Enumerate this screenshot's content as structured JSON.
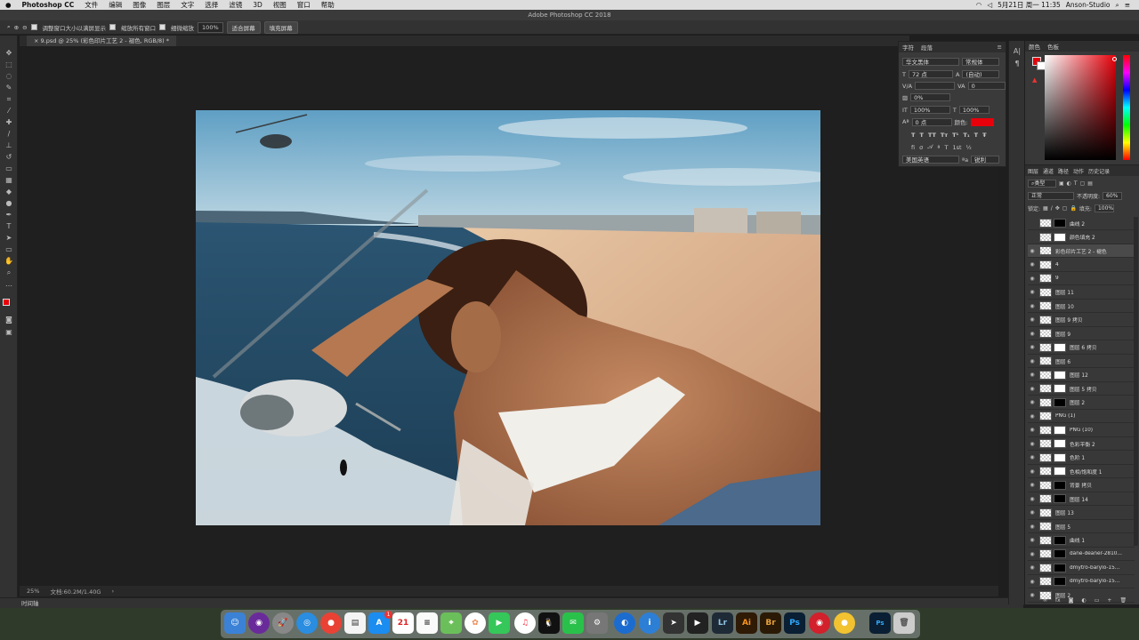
{
  "menubar": {
    "apple": "",
    "items": [
      "Photoshop CC",
      "文件",
      "编辑",
      "图像",
      "图层",
      "文字",
      "选择",
      "滤镜",
      "3D",
      "视图",
      "窗口",
      "帮助"
    ],
    "clock": "5月21日 周一  11:35",
    "user": "Anson-Studio"
  },
  "window": {
    "title": "Adobe Photoshop CC 2018"
  },
  "options": {
    "resize": "调整窗口大小以满屏显示",
    "zoom_all": "缩放所有窗口",
    "scrubby": "细微缩放",
    "zoom_value": "100%",
    "fit": "适合屏幕",
    "fill": "填充屏幕"
  },
  "document": {
    "tab": "9.psd @ 25% (彩色印片工艺 2 - 褪色, RGB/8) *",
    "zoom": "25%",
    "docsize": "文档:60.2M/1.40G"
  },
  "timeline": {
    "label": "时间轴"
  },
  "character": {
    "tabs": [
      "字符",
      "段落"
    ],
    "font": "华文黑体",
    "style": "常规体",
    "size": "72 点",
    "leading": "(自动)",
    "kerning": "",
    "tracking": "0",
    "scale_pct": "0%",
    "vscale": "100%",
    "hscale": "100%",
    "baseline": "0 点",
    "color_label": "颜色:",
    "language": "美国英语",
    "aa": "锐利",
    "color": "#e8000a"
  },
  "color_panel": {
    "tabs": [
      "颜色",
      "色板"
    ],
    "fg": "#e8000a",
    "bg": "#ffffff"
  },
  "layers": {
    "tabs": [
      "图层",
      "通道",
      "路径",
      "动作",
      "历史记录"
    ],
    "kind": "类型",
    "blend": "正常",
    "opacity_label": "不透明度:",
    "opacity": "60%",
    "lock_label": "锁定:",
    "fill_label": "填充:",
    "fill": "100%",
    "rows": [
      {
        "name": "曲线 2",
        "visible": false,
        "mask": "blk"
      },
      {
        "name": "颜色填充 2",
        "visible": false,
        "mask": "white"
      },
      {
        "name": "彩色印片工艺 2 - 褪色",
        "visible": true,
        "mask": "none",
        "selected": true
      },
      {
        "name": "4",
        "visible": true,
        "mask": "none"
      },
      {
        "name": "9",
        "visible": true,
        "mask": "none"
      },
      {
        "name": "图层 11",
        "visible": true,
        "mask": "none"
      },
      {
        "name": "图层 10",
        "visible": true,
        "mask": "none"
      },
      {
        "name": "图层 9 拷贝",
        "visible": true,
        "mask": "none"
      },
      {
        "name": "图层 9",
        "visible": true,
        "mask": "none"
      },
      {
        "name": "图层 6 拷贝",
        "visible": true,
        "mask": "white"
      },
      {
        "name": "图层 6",
        "visible": true,
        "mask": "none"
      },
      {
        "name": "图层 12",
        "visible": true,
        "mask": "white"
      },
      {
        "name": "图层 5 拷贝",
        "visible": true,
        "mask": "white"
      },
      {
        "name": "图层 2",
        "visible": true,
        "mask": "blk"
      },
      {
        "name": "PNG (1)",
        "visible": true,
        "mask": "none"
      },
      {
        "name": "PNG (10)",
        "visible": true,
        "mask": "white"
      },
      {
        "name": "色彩平衡 2",
        "visible": true,
        "mask": "white"
      },
      {
        "name": "色阶 1",
        "visible": true,
        "mask": "white"
      },
      {
        "name": "色相/饱和度 1",
        "visible": true,
        "mask": "white"
      },
      {
        "name": "背景 拷贝",
        "visible": true,
        "mask": "blk"
      },
      {
        "name": "图层 14",
        "visible": true,
        "mask": "blk"
      },
      {
        "name": "图层 13",
        "visible": true,
        "mask": "none"
      },
      {
        "name": "图层 5",
        "visible": true,
        "mask": "none"
      },
      {
        "name": "曲线 1",
        "visible": true,
        "mask": "blk"
      },
      {
        "name": "dane-deaner-2810...",
        "visible": true,
        "mask": "blk"
      },
      {
        "name": "dmytro-barylo-15...",
        "visible": true,
        "mask": "blk"
      },
      {
        "name": "dmytro-barylo-15...",
        "visible": true,
        "mask": "blk"
      },
      {
        "name": "图层 2",
        "visible": true,
        "mask": "none"
      }
    ]
  },
  "dock": {
    "calendar_day": "21",
    "appstore_badge": "1",
    "apps": [
      "Lr",
      "Ai",
      "Br",
      "Ps"
    ]
  }
}
